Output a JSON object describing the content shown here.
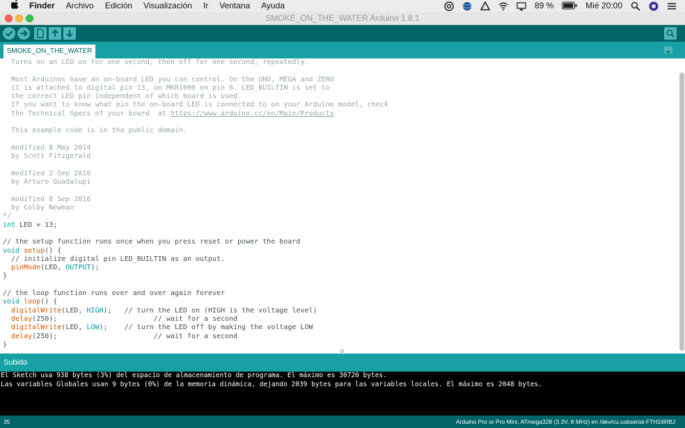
{
  "menubar": {
    "app_name": "Finder",
    "items": [
      "Archivo",
      "Edición",
      "Visualización",
      "Ir",
      "Ventana",
      "Ayuda"
    ],
    "battery": "89 %",
    "clock": "Mié 20:00"
  },
  "window": {
    "title": "SMOKE_ON_THE_WATER Arduino 1.8.1"
  },
  "tab": {
    "active_label": "SMOKE_ON_THE_WATER"
  },
  "code_lines": [
    [
      {
        "t": "c",
        "s": "  Turns on an LED on for one second, then off for one second, repeatedly."
      }
    ],
    [
      {
        "t": "c",
        "s": ""
      }
    ],
    [
      {
        "t": "c",
        "s": "  Most Arduinos have an on-board LED you can control. On the UNO, MEGA and ZERO"
      }
    ],
    [
      {
        "t": "c",
        "s": "  it is attached to digital pin 13, on MKR1000 on pin 6. LED_BUILTIN is set to"
      }
    ],
    [
      {
        "t": "c",
        "s": "  the correct LED pin independent of which board is used."
      }
    ],
    [
      {
        "t": "c",
        "s": "  If you want to know what pin the on-board LED is connected to on your Arduino model, check"
      }
    ],
    [
      {
        "t": "c",
        "s": "  the Technical Specs of your board  at "
      },
      {
        "t": "u",
        "s": "https://www.arduino.cc/en/Main/Products"
      }
    ],
    [
      {
        "t": "c",
        "s": ""
      }
    ],
    [
      {
        "t": "c",
        "s": "  This example code is in the public domain."
      }
    ],
    [
      {
        "t": "c",
        "s": ""
      }
    ],
    [
      {
        "t": "c",
        "s": "  modified 8 May 2014"
      }
    ],
    [
      {
        "t": "c",
        "s": "  by Scott Fitzgerald"
      }
    ],
    [
      {
        "t": "c",
        "s": ""
      }
    ],
    [
      {
        "t": "c",
        "s": "  modified 2 Sep 2016"
      }
    ],
    [
      {
        "t": "c",
        "s": "  by Arturo Guadalupi"
      }
    ],
    [
      {
        "t": "c",
        "s": ""
      }
    ],
    [
      {
        "t": "c",
        "s": "  modified 8 Sep 2016"
      }
    ],
    [
      {
        "t": "c",
        "s": "  by Colby Newman"
      }
    ],
    [
      {
        "t": "c",
        "s": "*/"
      }
    ],
    [
      {
        "t": "k",
        "s": "int"
      },
      {
        "t": "t",
        "s": " LED = 13;"
      }
    ],
    [
      {
        "t": "t",
        "s": ""
      }
    ],
    [
      {
        "t": "t",
        "s": "// the setup function runs once when you press reset or power the board"
      }
    ],
    [
      {
        "t": "k",
        "s": "void"
      },
      {
        "t": "t",
        "s": " "
      },
      {
        "t": "f",
        "s": "setup"
      },
      {
        "t": "t",
        "s": "() {"
      }
    ],
    [
      {
        "t": "t",
        "s": "  // initialize digital pin LED_BUILTIN as an output."
      }
    ],
    [
      {
        "t": "t",
        "s": "  "
      },
      {
        "t": "f",
        "s": "pinMode"
      },
      {
        "t": "t",
        "s": "(LED, "
      },
      {
        "t": "k",
        "s": "OUTPUT"
      },
      {
        "t": "t",
        "s": ");"
      }
    ],
    [
      {
        "t": "t",
        "s": "}"
      }
    ],
    [
      {
        "t": "t",
        "s": ""
      }
    ],
    [
      {
        "t": "t",
        "s": "// the loop function runs over and over again forever"
      }
    ],
    [
      {
        "t": "k",
        "s": "void"
      },
      {
        "t": "t",
        "s": " "
      },
      {
        "t": "f",
        "s": "loop"
      },
      {
        "t": "t",
        "s": "() {"
      }
    ],
    [
      {
        "t": "t",
        "s": "  "
      },
      {
        "t": "f",
        "s": "digitalWrite"
      },
      {
        "t": "t",
        "s": "(LED, "
      },
      {
        "t": "k",
        "s": "HIGH"
      },
      {
        "t": "t",
        "s": ");   // turn the LED on (HIGH is the voltage level)"
      }
    ],
    [
      {
        "t": "t",
        "s": "  "
      },
      {
        "t": "f",
        "s": "delay"
      },
      {
        "t": "t",
        "s": "(250);                       // wait for a second"
      }
    ],
    [
      {
        "t": "t",
        "s": "  "
      },
      {
        "t": "f",
        "s": "digitalWrite"
      },
      {
        "t": "t",
        "s": "(LED, "
      },
      {
        "t": "k",
        "s": "LOW"
      },
      {
        "t": "t",
        "s": ");    // turn the LED off by making the voltage LOW"
      }
    ],
    [
      {
        "t": "t",
        "s": "  "
      },
      {
        "t": "f",
        "s": "delay"
      },
      {
        "t": "t",
        "s": "(250);                       // wait for a second"
      }
    ],
    [
      {
        "t": "t",
        "s": "}"
      }
    ]
  ],
  "status": {
    "text": "Subido"
  },
  "console": {
    "lines": [
      "El Sketch usa 938 bytes (3%) del espacio de almacenamiento de programa. El máximo es 30720 bytes.",
      "Las variables Globales usan 9 bytes (0%) de la memoria dinámica, dejando 2039 bytes para las variables locales. El máximo es 2048 bytes."
    ]
  },
  "footer": {
    "line_number": "35",
    "board_info": "Arduino Pro or Pro Mini, ATmega328 (3.3V, 8 MHz) en /dev/cu.usbserial-FTH16RBJ"
  },
  "icons": {
    "verify": "checkmark-icon",
    "upload": "arrow-right-icon",
    "new": "new-file-icon",
    "open": "arrow-up-icon",
    "save": "arrow-down-icon",
    "serial_monitor": "magnifier-icon"
  },
  "colors": {
    "toolbar": "#006468",
    "tabbar": "#17a1a5",
    "comment": "#95a5a6",
    "keyword": "#00979c",
    "function": "#d35400"
  }
}
